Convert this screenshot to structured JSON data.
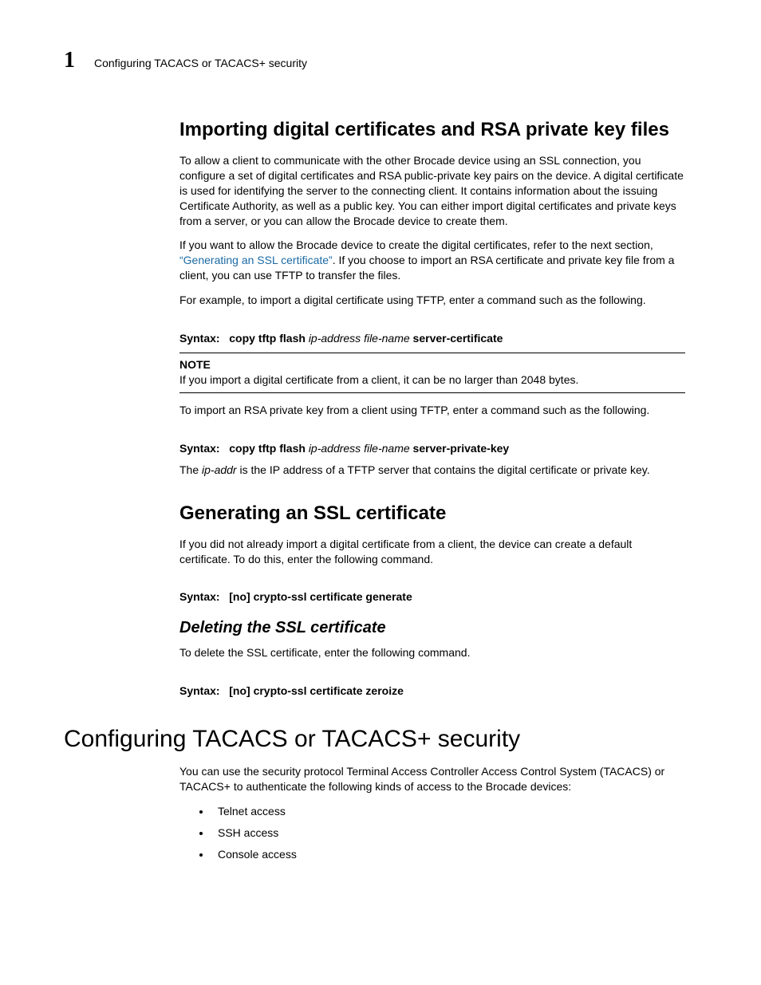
{
  "header": {
    "chapter_number": "1",
    "running_head": "Configuring TACACS or TACACS+ security"
  },
  "section_import": {
    "heading": "Importing digital certificates and RSA private key files",
    "p1": "To allow a client to communicate with the other Brocade device using an SSL connection, you configure a set of digital certificates and RSA public-private key pairs on the device. A digital certificate is used for identifying the server to the connecting client. It contains information about the issuing Certificate Authority, as well as a public key. You can either import digital certificates and private keys from a server, or you can allow the Brocade device to create them.",
    "p2_pre": "If you want to allow the Brocade device to create the digital certificates, refer to the next section, ",
    "p2_link": "“Generating an SSL certificate”",
    "p2_post": ". If you choose to import an RSA certificate and private key file from a client, you can use TFTP to transfer the files.",
    "p3": "For example, to import a digital certificate using TFTP, enter a command such as the following.",
    "syntax1_label": "Syntax:",
    "syntax1_cmd": "copy tftp flash",
    "syntax1_args": "ip-address file-name",
    "syntax1_tail": "server-certificate",
    "note_label": "NOTE",
    "note_body": "If you import a digital certificate from a client, it can be no larger than 2048 bytes.",
    "p4": "To import an RSA private key from a client using TFTP, enter a command such as the following.",
    "syntax2_label": "Syntax:",
    "syntax2_cmd": "copy tftp flash",
    "syntax2_args": "ip-address file-name",
    "syntax2_tail": "server-private-key",
    "p5_pre": "The ",
    "p5_ital": "ip-addr",
    "p5_post": " is the IP address of a TFTP server that contains the digital certificate or private key."
  },
  "section_gen": {
    "heading": "Generating an SSL certificate",
    "p1": "If you did not already import a digital certificate from a client, the device can create a default certificate. To do this, enter the following command.",
    "syntax_label": "Syntax:",
    "syntax_cmd": "[no] crypto-ssl certificate generate"
  },
  "section_del": {
    "heading": "Deleting the SSL certificate",
    "p1": "To delete the SSL certificate, enter the following command.",
    "syntax_label": "Syntax:",
    "syntax_cmd": "[no] crypto-ssl certificate zeroize"
  },
  "section_tacacs": {
    "heading": "Configuring TACACS or TACACS+ security",
    "p1": "You can use the security protocol Terminal Access Controller Access Control System (TACACS) or TACACS+ to authenticate the following kinds of access to the Brocade devices:",
    "bullets": [
      "Telnet access",
      "SSH access",
      "Console access"
    ]
  }
}
